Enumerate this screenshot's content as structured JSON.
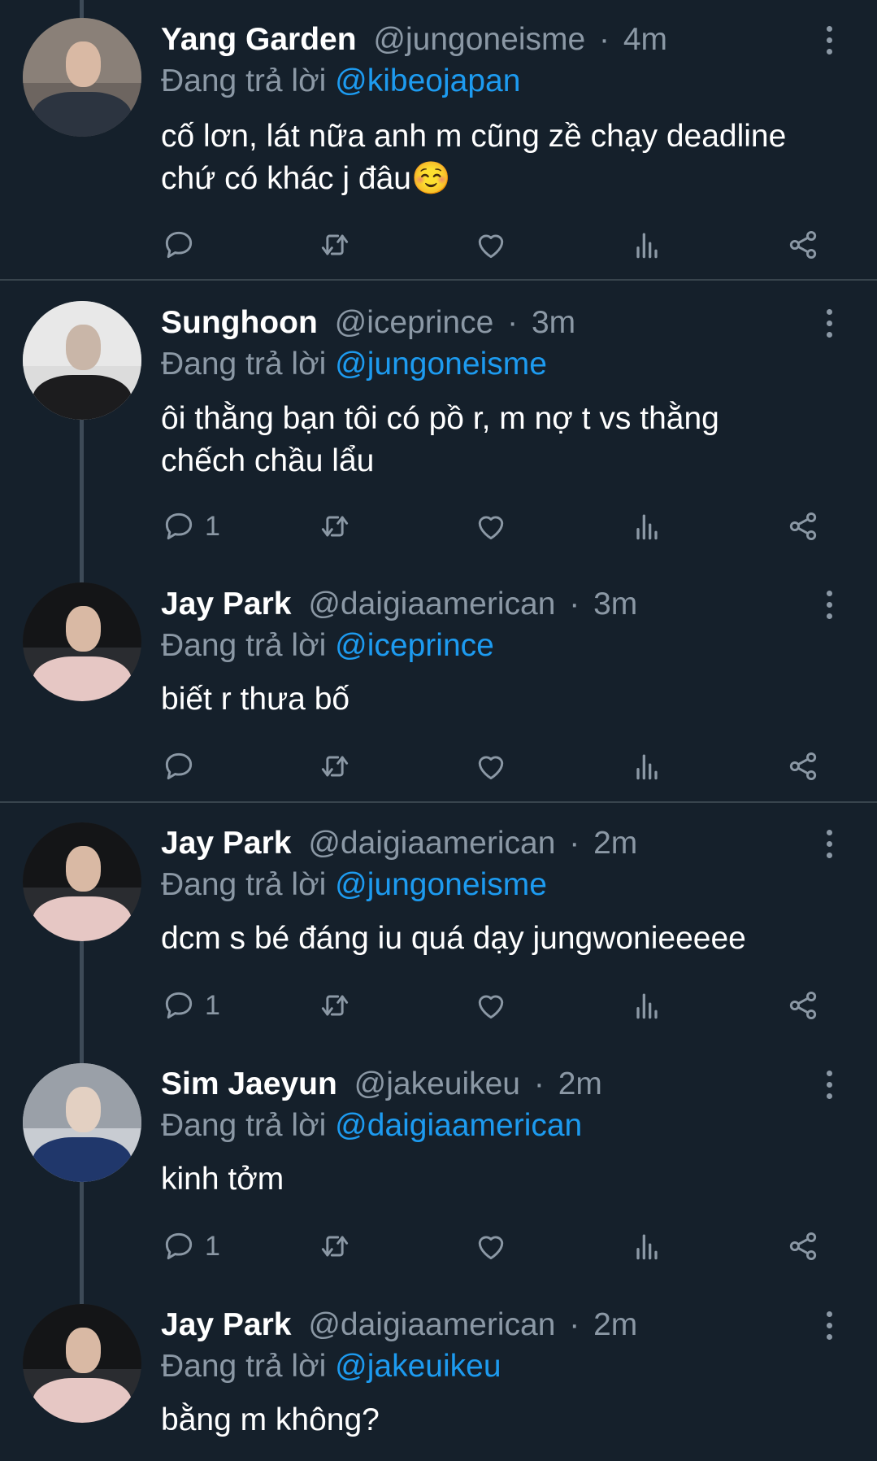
{
  "reply_prefix": "Đang trả lời",
  "tweets": [
    {
      "name": "Yang Garden",
      "handle": "@jungoneisme",
      "time": "4m",
      "reply_to": "@kibeojapan",
      "lines": [
        "cố lơn, lát nữa anh m cũng zề chạy deadline",
        "chứ có khác j đâu☺️"
      ],
      "reply_count": ""
    },
    {
      "name": "Sunghoon",
      "handle": "@iceprince",
      "time": "3m",
      "reply_to": "@jungoneisme",
      "lines": [
        "ôi thằng bạn tôi có pồ r, m nợ t vs thằng",
        "chếch chầu lẩu"
      ],
      "reply_count": "1"
    },
    {
      "name": "Jay Park",
      "handle": "@daigiaamerican",
      "time": "3m",
      "reply_to": "@iceprince",
      "lines": [
        "biết r thưa bố"
      ],
      "reply_count": ""
    },
    {
      "name": "Jay Park",
      "handle": "@daigiaamerican",
      "time": "2m",
      "reply_to": "@jungoneisme",
      "lines": [
        "dcm s bé đáng iu quá dạy jungwonieeeee"
      ],
      "reply_count": "1"
    },
    {
      "name": "Sim Jaeyun",
      "handle": "@jakeuikeu",
      "time": "2m",
      "reply_to": "@daigiaamerican",
      "lines": [
        "kinh tởm"
      ],
      "reply_count": "1"
    },
    {
      "name": "Jay Park",
      "handle": "@daigiaamerican",
      "time": "2m",
      "reply_to": "@jakeuikeu",
      "lines": [
        "bằng m không?"
      ],
      "reply_count": ""
    }
  ],
  "icons": {
    "reply": "reply-icon",
    "retweet": "retweet-icon",
    "like": "heart-icon",
    "views": "views-chart-icon",
    "share": "share-icon",
    "more": "more-vertical-icon"
  },
  "colors": {
    "background": "#15202b",
    "mention": "#1d9bf0",
    "muted": "#8b98a5",
    "divider": "#38444d"
  }
}
